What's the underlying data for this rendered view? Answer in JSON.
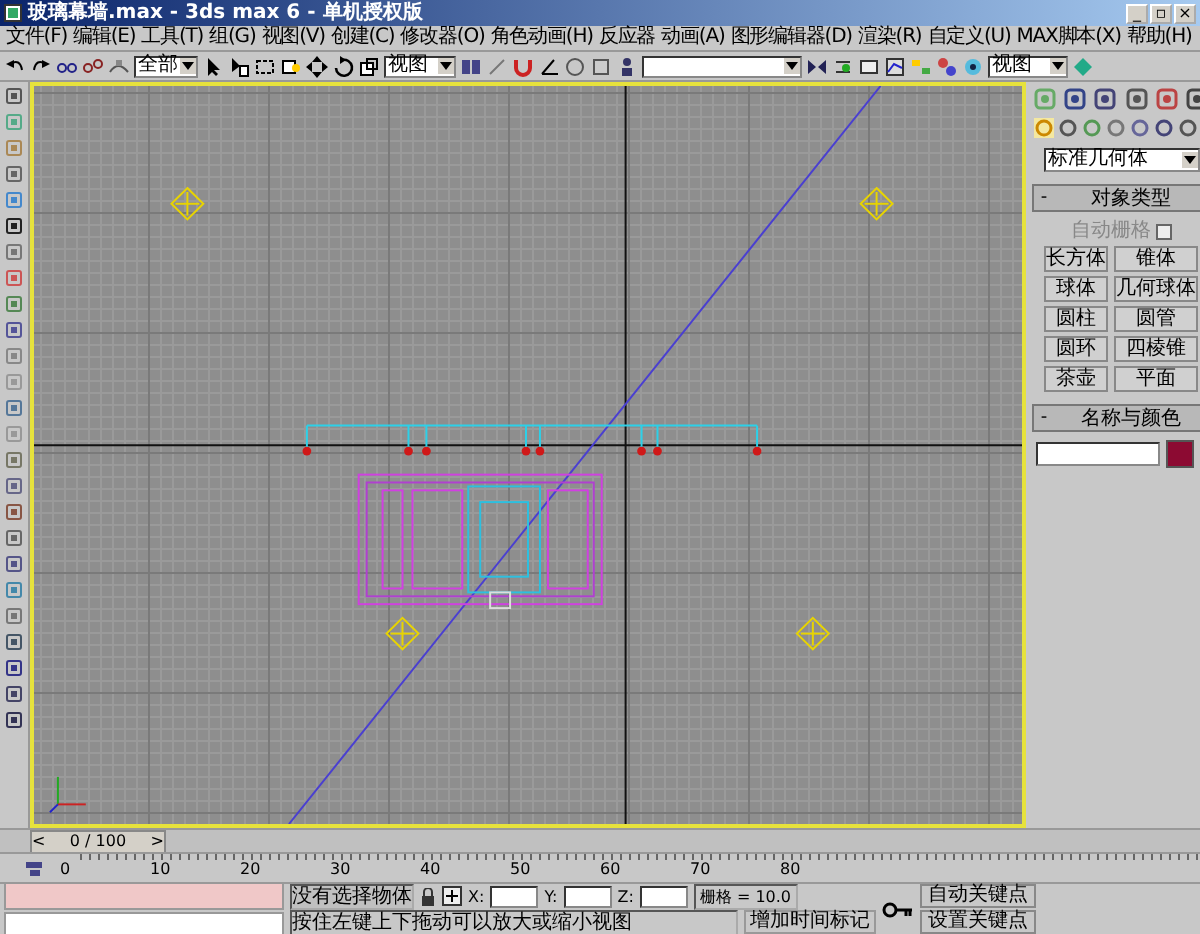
{
  "window": {
    "title": "玻璃幕墙.max - 3ds max 6 - 单机授权版",
    "controls": [
      "_",
      "▫",
      "×"
    ]
  },
  "menu": [
    "文件(F)",
    "编辑(E)",
    "工具(T)",
    "组(G)",
    "视图(V)",
    "创建(C)",
    "修改器(O)",
    "角色动画(H)",
    "反应器",
    "动画(A)",
    "图形编辑器(D)",
    "渲染(R)",
    "自定义(U)",
    "MAX脚本(X)",
    "帮助(H)"
  ],
  "toolbar": {
    "selection_filter": "全部",
    "reference_coord": "视图",
    "render_view": "视图"
  },
  "command_panel": {
    "category": "标准几何体",
    "rollouts": [
      {
        "sign": "-",
        "title": "对象类型",
        "autogrid": {
          "label": "自动栅格",
          "checked": false
        },
        "buttons": [
          "长方体",
          "锥体",
          "球体",
          "几何球体",
          "圆柱",
          "圆管",
          "圆环",
          "四棱锥",
          "茶壶",
          "平面"
        ]
      },
      {
        "sign": "-",
        "title": "名称与颜色",
        "color": "#8c0a32"
      }
    ]
  },
  "time_slider": {
    "prev": "<",
    "label": "0 / 100",
    "next": ">",
    "level": 0
  },
  "ruler": [
    "0",
    "10",
    "20",
    "30",
    "40",
    "50",
    "60",
    "70",
    "80"
  ],
  "status": {
    "selection": "没有选择物体",
    "prompt": "按住左键上下拖动可以放大或缩小视图",
    "coords": [
      {
        "label": "X:"
      },
      {
        "label": "Y:"
      },
      {
        "label": "Z:"
      }
    ],
    "grid": "栅格 = 10.0",
    "add_time_tag": "增加时间标记",
    "auto_key": "自动关键点",
    "set_key": "设置关键点"
  }
}
